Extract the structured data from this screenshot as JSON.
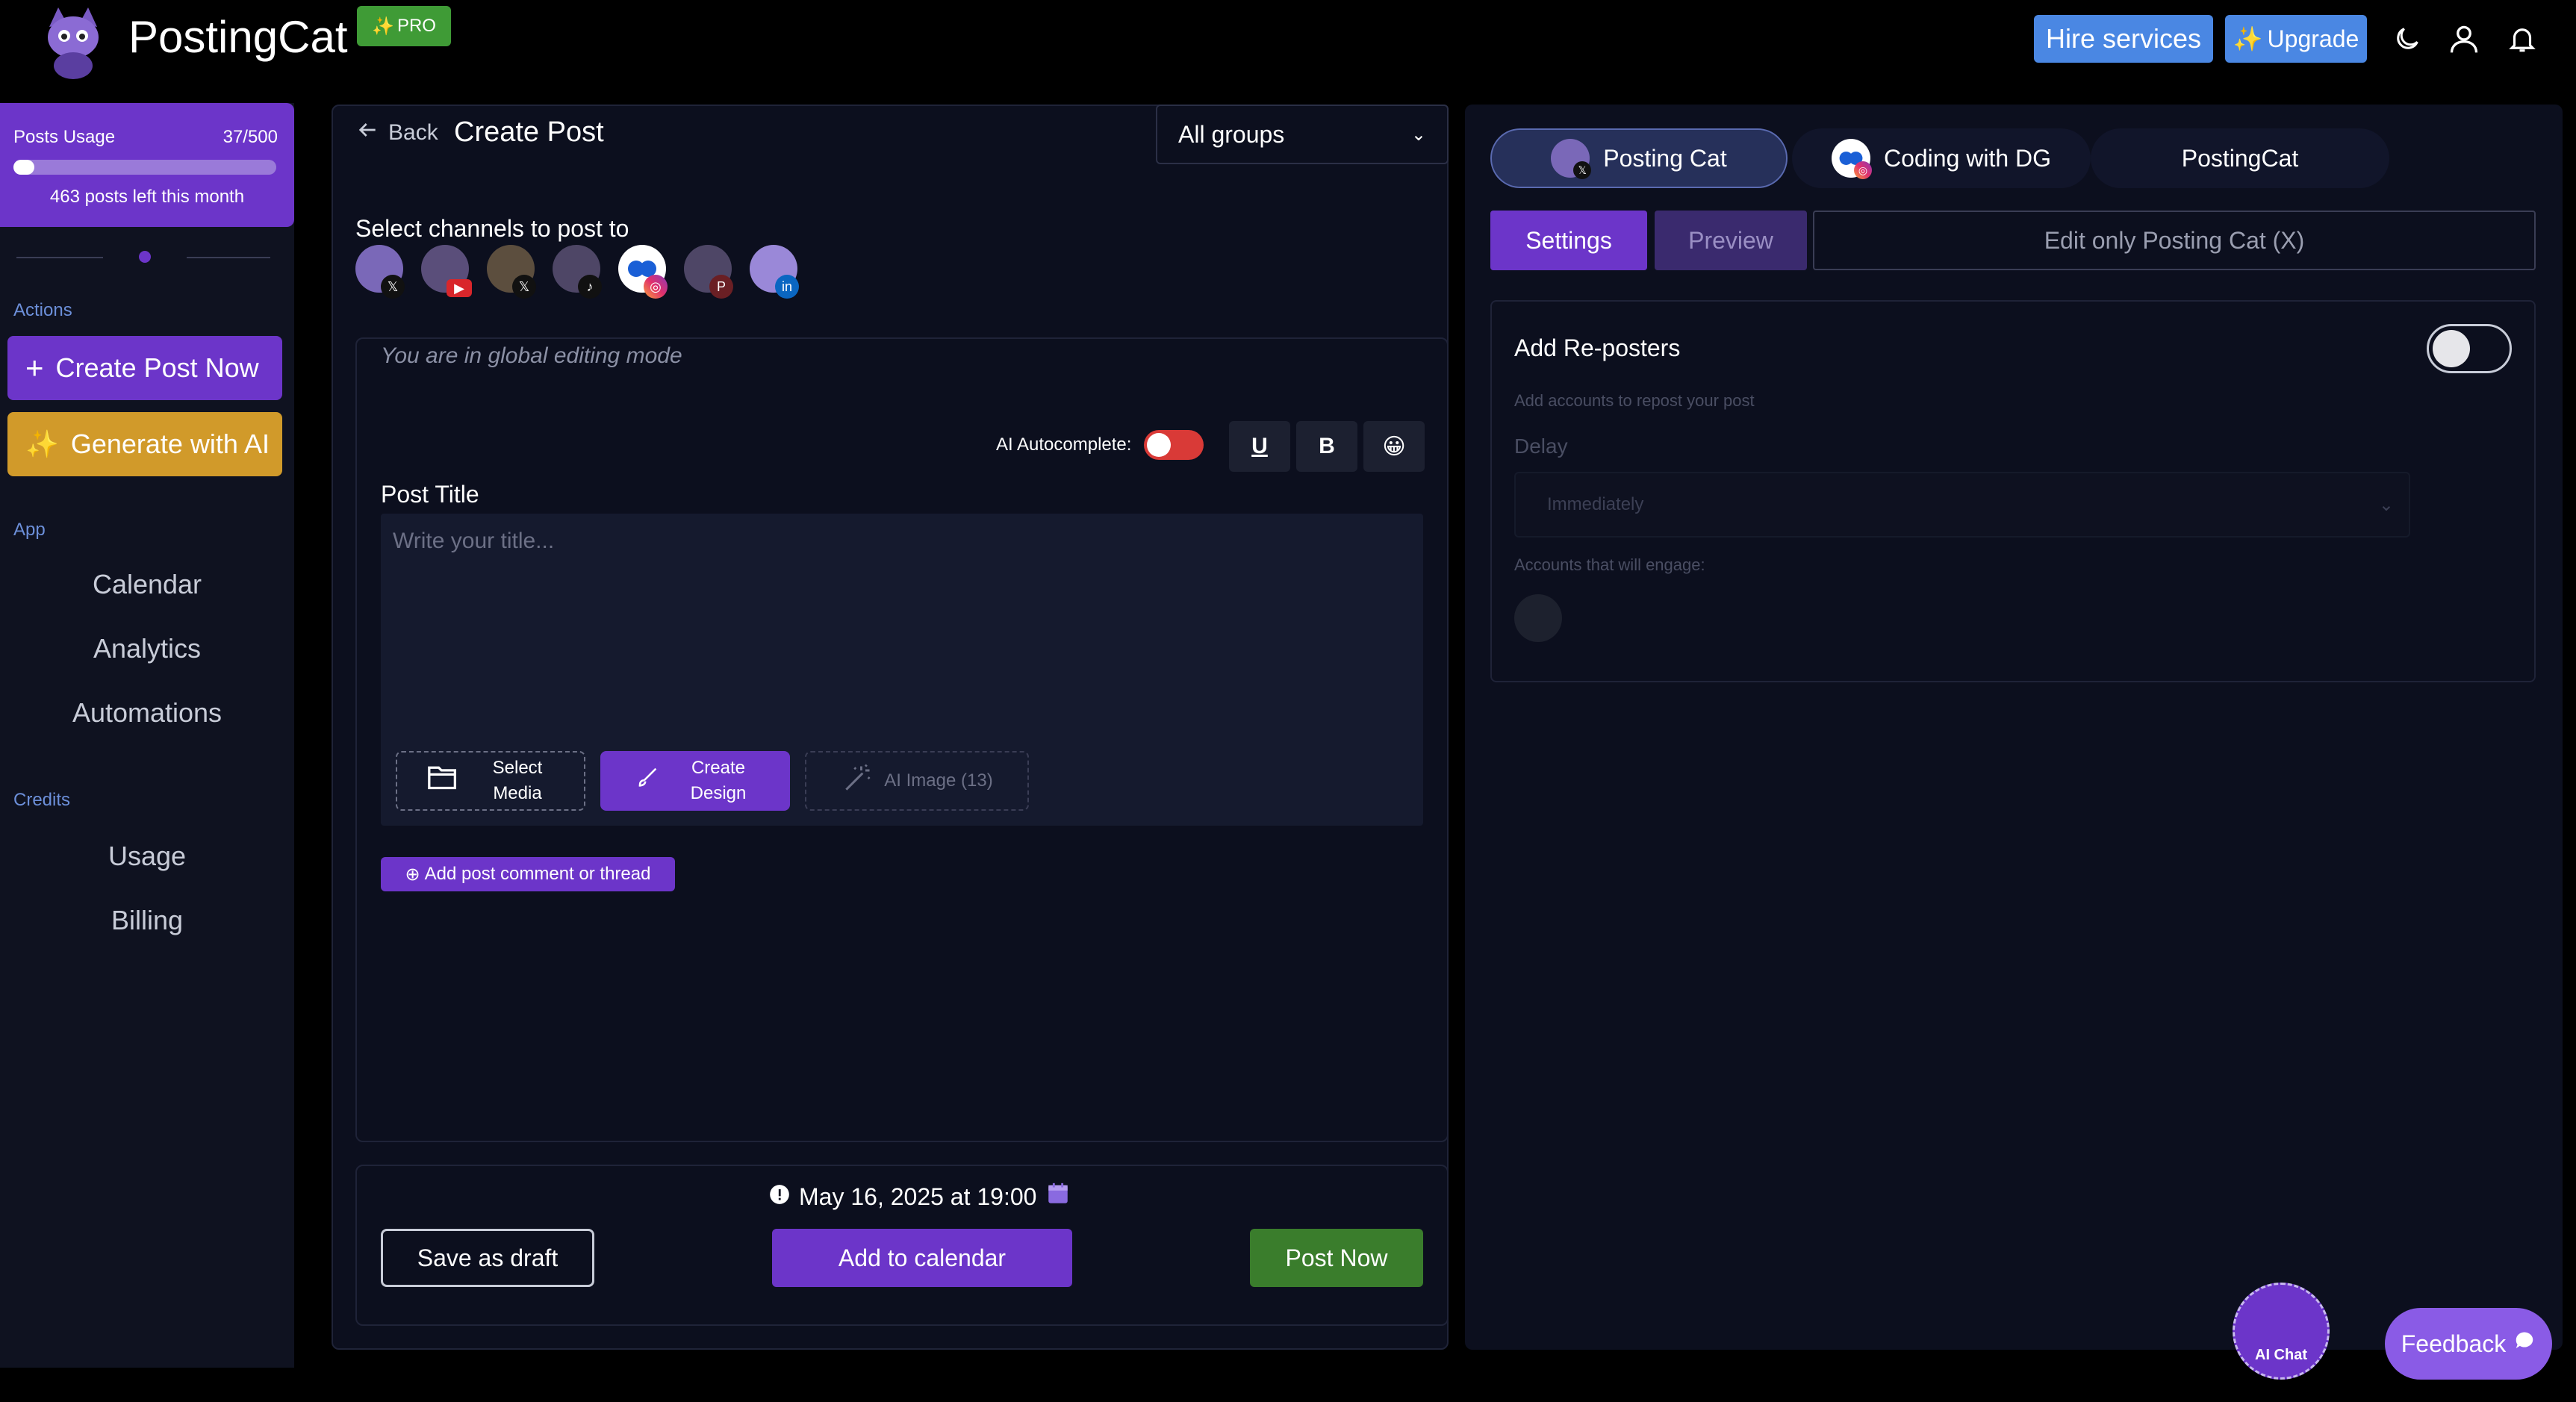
{
  "brand": {
    "name": "PostingCat",
    "badge": "PRO"
  },
  "header": {
    "hire_label": "Hire services",
    "upgrade_label": "Upgrade"
  },
  "usage": {
    "title": "Posts Usage",
    "count": "37/500",
    "left_text": "463 posts left this month",
    "used_fraction": 0.074
  },
  "sidebar": {
    "actions_heading": "Actions",
    "create_post_label": "Create Post Now",
    "generate_ai_label": "Generate with AI",
    "app_heading": "App",
    "app_items": [
      "Calendar",
      "Analytics",
      "Automations"
    ],
    "credits_heading": "Credits",
    "credit_items": [
      "Usage",
      "Billing"
    ]
  },
  "editor": {
    "back_label": "Back",
    "title": "Create Post",
    "groups_value": "All groups",
    "channels_label": "Select channels to post to",
    "channels": [
      {
        "network": "x",
        "icon": "x-icon"
      },
      {
        "network": "youtube",
        "icon": "youtube-icon"
      },
      {
        "network": "x",
        "icon": "x-icon"
      },
      {
        "network": "tiktok",
        "icon": "tiktok-icon"
      },
      {
        "network": "instagram",
        "icon": "instagram-icon"
      },
      {
        "network": "pinterest",
        "icon": "pinterest-icon"
      },
      {
        "network": "linkedin",
        "icon": "linkedin-icon"
      }
    ],
    "global_note": "You are in global editing mode",
    "ai_autocomplete_label": "AI Autocomplete:",
    "fmt_underline": "U",
    "fmt_bold": "B",
    "fmt_emoji": "😀",
    "post_title_label": "Post Title",
    "title_placeholder": "Write your title...",
    "select_media_label": "Select Media",
    "create_design_label": "Create Design",
    "ai_image_label": "AI Image (13)",
    "add_comment_label": "Add post comment or thread",
    "date_label": "May 16, 2025 at 19:00",
    "save_draft_label": "Save as draft",
    "add_calendar_label": "Add to calendar",
    "post_now_label": "Post Now"
  },
  "preview": {
    "accounts": [
      "Posting Cat",
      "Coding with DG",
      "PostingCat"
    ],
    "settings_tab": "Settings",
    "preview_tab": "Preview",
    "edit_only_label": "Edit only Posting Cat (X)",
    "reposters_title": "Add Re-posters",
    "reposters_sub": "Add accounts to repost your post",
    "delay_label": "Delay",
    "delay_value": "Immediately",
    "engage_label": "Accounts that will engage:"
  },
  "ai_chat_label": "AI Chat",
  "feedback_label": "Feedback",
  "colors": {
    "accent": "#6c35c9",
    "header_blue": "#4a87e3",
    "ai_gold": "#d19a2a",
    "post_green": "#3a7d2c",
    "toggle_red": "#d93a37"
  }
}
